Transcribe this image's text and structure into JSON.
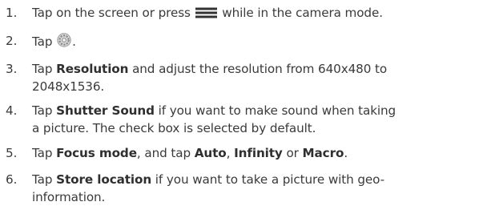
{
  "steps": [
    {
      "number": "1.",
      "lines": [
        {
          "pre": "Tap on the screen or press ",
          "icon": "menu-icon",
          "post": " while in the camera mode."
        }
      ]
    },
    {
      "number": "2.",
      "lines": [
        {
          "pre": "Tap ",
          "icon": "settings-gear-icon",
          "post": "."
        }
      ]
    },
    {
      "number": "3.",
      "lines": [
        {
          "pre": "Tap ",
          "bold": "Resolution",
          "post": " and adjust the resolution from 640x480 to"
        },
        {
          "text": "2048x1536."
        }
      ]
    },
    {
      "number": "4.",
      "lines": [
        {
          "pre": "Tap ",
          "bold": "Shutter Sound",
          "post": " if you want to make sound when taking"
        },
        {
          "text": "a picture. The check box is selected by default."
        }
      ]
    },
    {
      "number": "5.",
      "segments": [
        "Tap ",
        "Focus mode",
        ", and tap ",
        "Auto",
        ", ",
        "Infinity",
        " or ",
        "Macro",
        "."
      ]
    },
    {
      "number": "6.",
      "lines": [
        {
          "pre": "Tap ",
          "bold": "Store location",
          "post": " if you want to take a picture with geo-"
        },
        {
          "text": "information."
        }
      ]
    }
  ]
}
